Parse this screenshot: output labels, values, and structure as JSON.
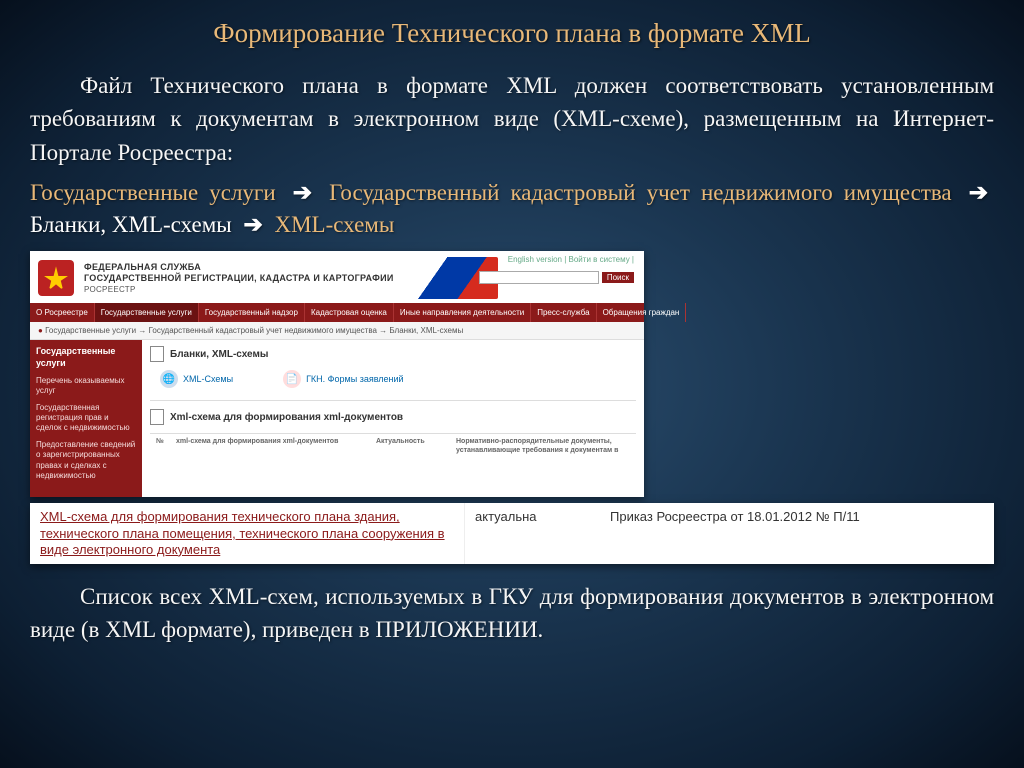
{
  "title": "Формирование Технического плана в формате XML",
  "para1": "Файл Технического плана в формате XML должен соответствовать установленным требованиям к документам в электронном виде (XML-схеме), размещенным на Интернет-Портале Росреестра:",
  "breadcrumb": {
    "b1": "Государственные услуги",
    "b2": "Государственный кадастровый учет недвижимого имущества",
    "b3": "Бланки, XML-схемы",
    "b4": "XML-схемы"
  },
  "shot": {
    "org_line1": "ФЕДЕРАЛЬНАЯ СЛУЖБА",
    "org_line2": "ГОСУДАРСТВЕННОЙ РЕГИСТРАЦИИ, КАДАСТРА И КАРТОГРАФИИ",
    "org_sub": "РОСРЕЕСТР",
    "top_links": "English version | Войти в систему | ",
    "search_btn": "Поиск",
    "nav": [
      "О Росреестре",
      "Государственные услуги",
      "Государственный надзор",
      "Кадастровая оценка",
      "Иные направления деятельности",
      "Пресс-служба",
      "Обращения граждан"
    ],
    "bc": "Государственные услуги → Государственный кадастровый учет недвижимого имущества → Бланки, XML-схемы",
    "side_head": "Государственные услуги",
    "side_items": [
      "Перечень оказываемых услуг",
      "Государственная регистрация прав и сделок с недвижимостью",
      "Предоставление сведений о зарегистрированных правах и сделках с недвижимостью"
    ],
    "page_h": "Бланки, XML-схемы",
    "link1": "XML-Схемы",
    "link2": "ГКН. Формы заявлений",
    "sub_h": "Xml-схема для формирования xml-документов",
    "th1": "№",
    "th2": "xml-схема для формирования xml-документов",
    "th3": "Актуальность",
    "th4": "Нормативно-распорядительные документы, устанавливающие требования к документам в"
  },
  "excerpt": {
    "c1": "XML-схема для формирования технического плана здания, технического плана помещения, технического плана сооружения в виде электронного документа",
    "c2": "актуальна",
    "c3": "Приказ Росреестра от 18.01.2012 № П/11"
  },
  "para2": "Список всех XML-схем, используемых в ГКУ для формирования документов в электронном виде (в XML формате), приведен в ПРИЛОЖЕНИИ."
}
